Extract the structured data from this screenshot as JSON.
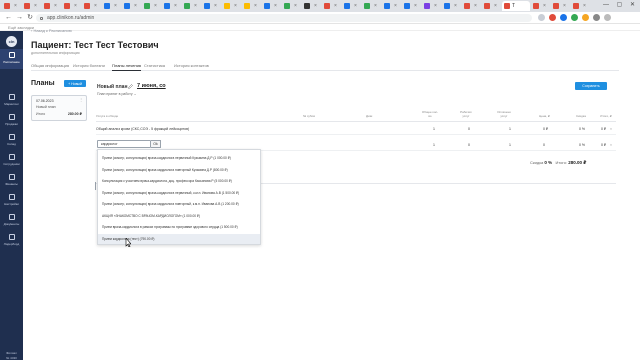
{
  "browser": {
    "url": "app.clinikon.ru/admin",
    "tabs": [
      {
        "color": "#e04b3a"
      },
      {
        "color": "#e04b3a"
      },
      {
        "color": "#e04b3a"
      },
      {
        "color": "#e04b3a"
      },
      {
        "color": "#e04b3a"
      },
      {
        "color": "#1a73e8"
      },
      {
        "color": "#1a73e8"
      },
      {
        "color": "#34a853"
      },
      {
        "color": "#1a73e8"
      },
      {
        "color": "#34a853"
      },
      {
        "color": "#1a73e8"
      },
      {
        "color": "#fbbc04"
      },
      {
        "color": "#fbbc04"
      },
      {
        "color": "#1a73e8"
      },
      {
        "color": "#34a853"
      },
      {
        "color": "#333333"
      },
      {
        "color": "#e04b3a"
      },
      {
        "color": "#1a73e8"
      },
      {
        "color": "#34a853"
      },
      {
        "color": "#1a73e8"
      },
      {
        "color": "#1a73e8"
      },
      {
        "color": "#7b3fe4"
      },
      {
        "color": "#1a73e8"
      },
      {
        "color": "#e04b3a"
      },
      {
        "color": "#e04b3a"
      },
      {
        "color": "#e04b3a"
      },
      {
        "color": "#e04b3a"
      },
      {
        "color": "#e04b3a"
      }
    ],
    "active_tab": {
      "label": "T"
    },
    "bookmark": "Ещё закладки"
  },
  "sidebar": {
    "logo": "cln",
    "items": [
      {
        "label": "Расписание",
        "icon": "calendar-icon"
      },
      {
        "label": "Маркетинг",
        "icon": "megaphone-icon"
      },
      {
        "label": "Продажи",
        "icon": "cart-icon"
      },
      {
        "label": "Склад",
        "icon": "box-icon"
      },
      {
        "label": "Сотрудники",
        "icon": "people-icon"
      },
      {
        "label": "Финансы",
        "icon": "wallet-icon"
      },
      {
        "label": "Настройки",
        "icon": "gear-icon"
      },
      {
        "label": "Документы",
        "icon": "document-icon"
      },
      {
        "label": "Лидерборд",
        "icon": "trophy-icon"
      }
    ],
    "footer_line1": "Филиал",
    "footer_line2": "№ 4430"
  },
  "breadcrumb": "‹ Назад к Расписанию",
  "patient": {
    "title": "Пациент: Тест Тест Тестович",
    "subtitle": "дополнительная информация"
  },
  "tabs": [
    {
      "label": "Общая информация"
    },
    {
      "label": "История болезни"
    },
    {
      "label": "Планы лечения"
    },
    {
      "label": "Статистика"
    },
    {
      "label": "История контактов"
    }
  ],
  "plans": {
    "title": "Планы",
    "add_label": "+ Новый",
    "card": {
      "date": "07.06.2023",
      "name": "Новый план",
      "total_label": "Итого",
      "total": "280.00 ₽",
      "menu": "⋮"
    }
  },
  "plan_detail": {
    "name": "Новый план",
    "doctor": "7 июня, со",
    "status": "План принят в работу ⌄",
    "save_label": "Сохранить"
  },
  "table": {
    "headers": [
      "Услуга в обходе",
      "№ зубов",
      "Диаг.",
      "Общее кол-во",
      "Рабочих услуг",
      "Оплачено услуг",
      "Цена, ₽",
      "Скидка",
      "Итого, ₽"
    ],
    "rows": [
      {
        "service": "Общий анализ крови (СКС,СОЭ - 5 фракций лейкоцитов)",
        "total": "1",
        "working": "0",
        "paid": "1",
        "price": "0 ₽",
        "discount": "0 %",
        "sum": "0 ₽",
        "del": "×"
      },
      {
        "service": "",
        "total": "1",
        "working": "0",
        "paid": "1",
        "price": "0",
        "discount": "0 %",
        "sum": "0 ₽",
        "del": "×"
      }
    ]
  },
  "search": {
    "value": "кардиолог",
    "go": "Ok"
  },
  "totals": {
    "discount_label": "Скидка",
    "discount": "0 %",
    "total_label": "Итого:",
    "total": "280.00 ₽"
  },
  "dropdown": {
    "items": [
      "Прием (осмотр, консультация) врача-кардиолога первичный Кузьмина Д.Р (1 000.00 ₽)",
      "Прием (осмотр, консультация) врача кардиолога повторный Кузьмина Д.Р (800.00 ₽)",
      "Консультация с участием врача-кардиолога, доц. профессора Касьянова Р (5 000.00 ₽)",
      "Прием (осмотр, консультация) врача-кардиолога первичный, к.м.н. Иванова А.В (1 500.00 ₽)",
      "Прием (осмотр, консультация) врача кардиолога повторный, к.м.н. Иванова А.В (1 200.00 ₽)",
      "АКЦИЯ «ЗНАКОМСТВО С ВРАЧОМ-КАРДИОЛОГОМ» (1 000.00 ₽)",
      "Прием врача-кардиолога в рамках программы по программе здорового сердца (1 500.00 ₽)",
      "Прием кардиолога (тест) (790.00 ₽)"
    ]
  }
}
